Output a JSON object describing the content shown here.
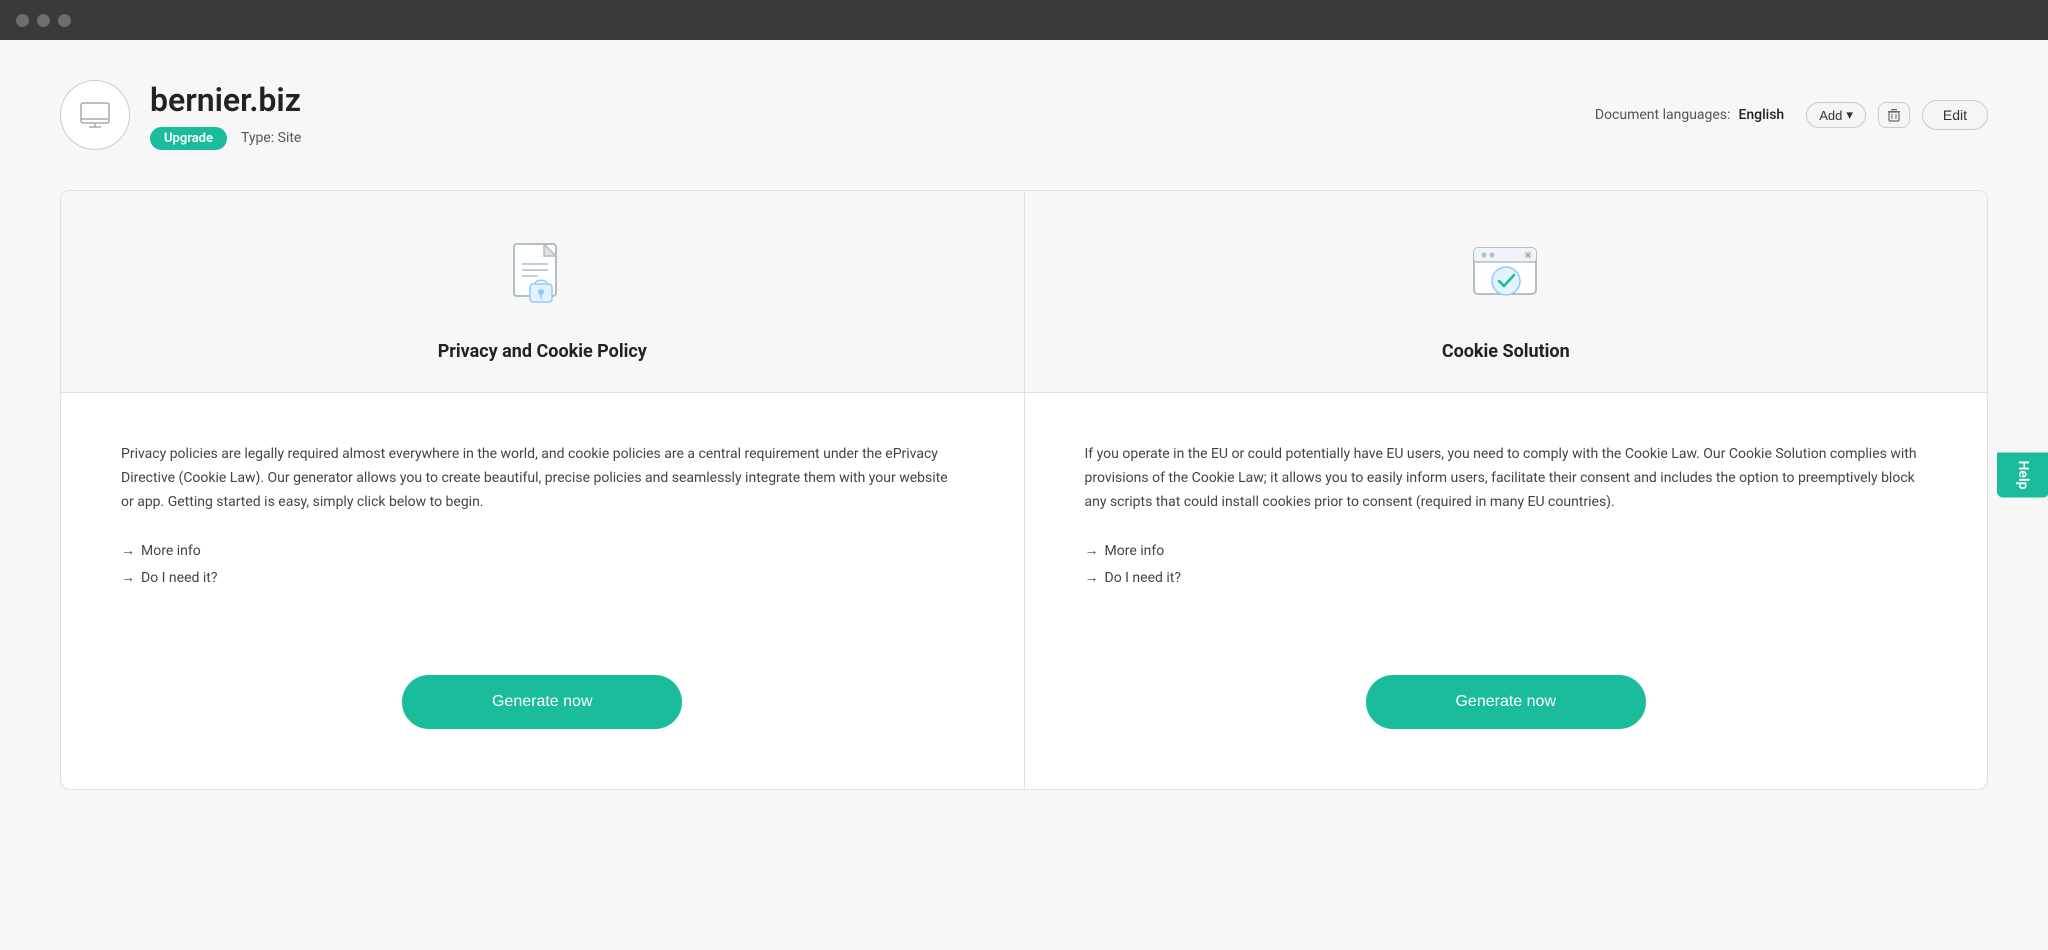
{
  "titlebar": {
    "dots": [
      "red-dot",
      "yellow-dot",
      "green-dot"
    ]
  },
  "header": {
    "site_name": "bernier.biz",
    "upgrade_label": "Upgrade",
    "type_label": "Type: Site",
    "edit_label": "Edit",
    "doc_languages_label": "Document languages:",
    "language": "English",
    "add_label": "Add",
    "delete_icon": "🗑"
  },
  "cards": [
    {
      "id": "privacy-policy",
      "icon_name": "privacy-cookie-icon",
      "title": "Privacy and Cookie Policy",
      "description": "Privacy policies are legally required almost everywhere in the world, and cookie policies are a central requirement under the ePrivacy Directive (Cookie Law). Our generator allows you to create beautiful, precise policies and seamlessly integrate them with your website or app. Getting started is easy, simply click below to begin.",
      "links": [
        {
          "label": "More info",
          "id": "more-info-privacy"
        },
        {
          "label": "Do I need it?",
          "id": "do-i-need-it-privacy"
        }
      ],
      "generate_label": "Generate now"
    },
    {
      "id": "cookie-solution",
      "icon_name": "cookie-solution-icon",
      "title": "Cookie Solution",
      "description": "If you operate in the EU or could potentially have EU users, you need to comply with the Cookie Law. Our Cookie Solution complies with provisions of the Cookie Law; it allows you to easily inform users, facilitate their consent and includes the option to preemptively block any scripts that could install cookies prior to consent (required in many EU countries).",
      "links": [
        {
          "label": "More info",
          "id": "more-info-cookie"
        },
        {
          "label": "Do I need it?",
          "id": "do-i-need-it-cookie"
        }
      ],
      "generate_label": "Generate now"
    }
  ],
  "help": {
    "label": "Help"
  }
}
